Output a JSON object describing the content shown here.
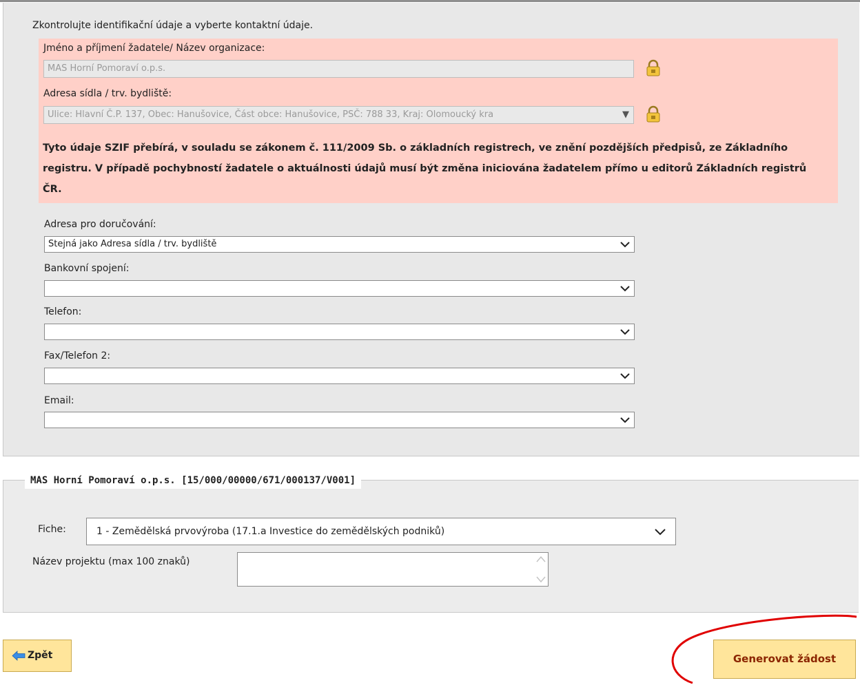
{
  "intro_text": "Zkontrolujte identifikační údaje a vyberte kontaktní údaje.",
  "identification": {
    "name_label": "Jméno a příjmení žadatele/ Název organizace:",
    "name_value": "MAS Horní Pomoraví o.p.s.",
    "address_label": "Adresa sídla / trv. bydliště:",
    "address_value": "Ulice: Hlavní Č.P. 137, Obec: Hanušovice, Část obce: Hanušovice, PSČ: 788 33, Kraj: Olomoucký kra",
    "warning_text": "Tyto údaje SZIF přebírá, v souladu se zákonem č. 111/2009 Sb. o základních registrech, ve znění pozdějších předpisů, ze Základního registru. V případě pochybností žadatele o aktuálnosti údajů musí být změna iniciována žadatelem přímo u editorů Základních registrů ČR."
  },
  "contact": {
    "delivery_label": "Adresa pro doručování:",
    "delivery_value": "Stejná jako Adresa sídla / trv. bydliště",
    "bank_label": "Bankovní spojení:",
    "bank_value": "",
    "phone_label": "Telefon:",
    "phone_value": "",
    "fax_label": "Fax/Telefon 2:",
    "fax_value": "",
    "email_label": "Email:",
    "email_value": ""
  },
  "project_section": {
    "legend": "MAS Horní Pomoraví o.p.s. [15/000/00000/671/000137/V001]",
    "fiche_label": "Fiche:",
    "fiche_value": "1 - Zemědělská prvovýroba (17.1.a Investice do zemědělských podniků)",
    "project_name_label": "Název projektu (max 100 znaků)",
    "project_name_value": ""
  },
  "buttons": {
    "back_label": "Zpět",
    "generate_label": "Generovat žádost"
  },
  "colors": {
    "warning_bg": "#ffd0c8",
    "button_bg": "#ffe59b",
    "highlight": "#e00000"
  },
  "icons": {
    "lock": "lock-icon",
    "chevron": "chevron-down-icon",
    "back": "arrow-left-icon"
  }
}
